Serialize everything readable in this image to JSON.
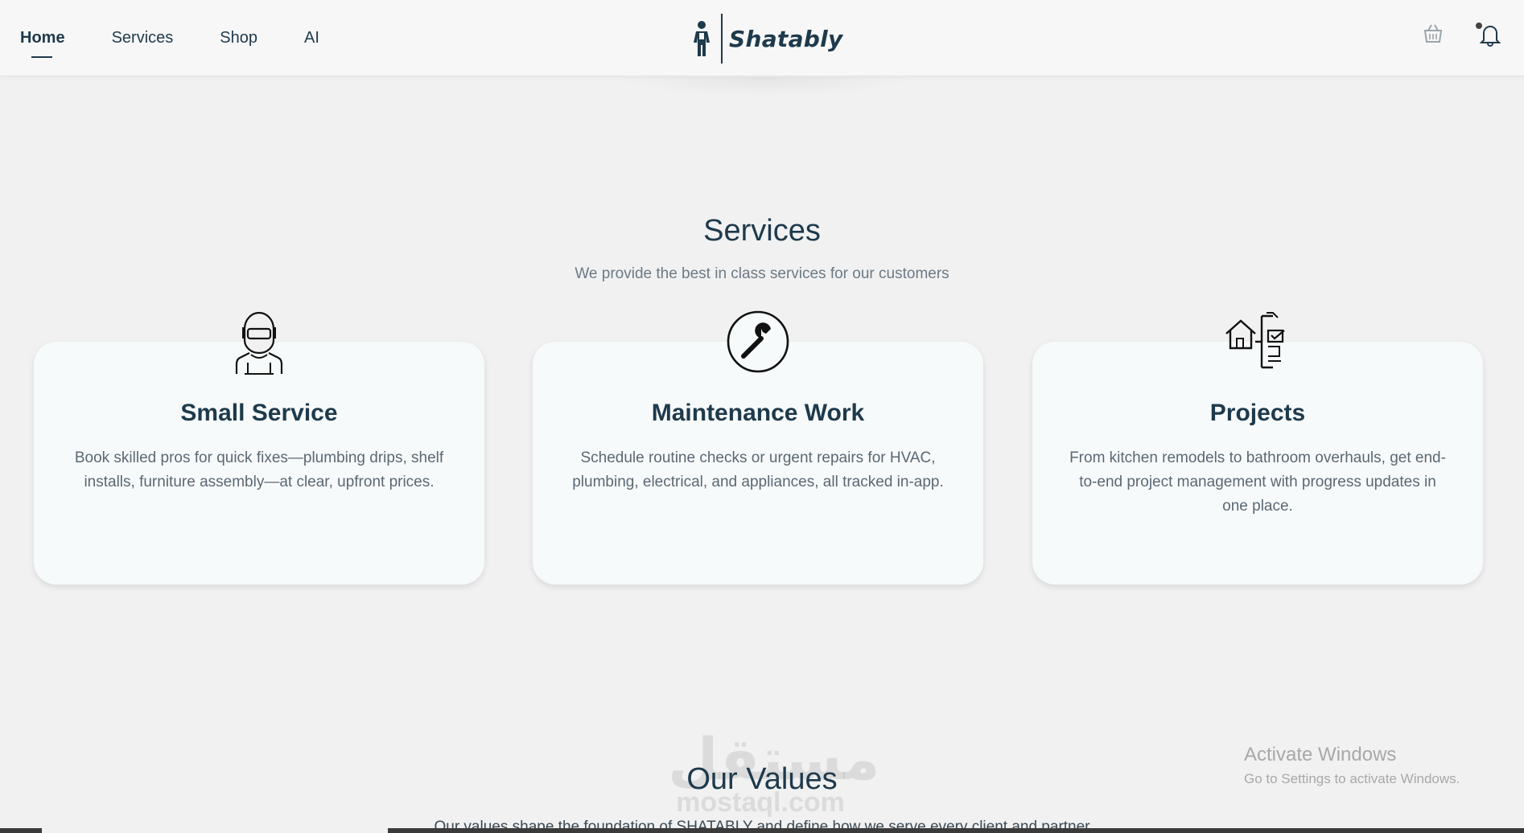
{
  "nav": {
    "items": [
      {
        "label": "Home",
        "active": true
      },
      {
        "label": "Services",
        "active": false
      },
      {
        "label": "Shop",
        "active": false
      },
      {
        "label": "AI",
        "active": false
      }
    ]
  },
  "brand": {
    "name": "Shatably",
    "color": "#1e3a4c"
  },
  "header_icons": [
    "basket-icon",
    "bell-icon",
    "user-icon"
  ],
  "services": {
    "title": "Services",
    "subtitle": "We provide the best in class services for our customers",
    "cards": [
      {
        "icon": "worker-icon",
        "title": "Small Service",
        "description": "Book skilled pros for quick fixes—plumbing drips, shelf installs, furniture assembly—at clear, upfront prices."
      },
      {
        "icon": "wrench-icon",
        "title": "Maintenance Work",
        "description": "Schedule routine checks or urgent repairs for HVAC, plumbing, electrical, and appliances, all tracked in-app."
      },
      {
        "icon": "house-checklist-icon",
        "title": "Projects",
        "description": "From kitchen remodels to bathroom overhauls, get end-to-end project management with progress updates in one place."
      }
    ]
  },
  "values": {
    "title": "Our Values",
    "intro_partial": "Our values shape the foundation of SHATABLY and define how we serve every client and partner"
  },
  "watermark": {
    "arabic": "مستقل",
    "latin": "mostaql.com"
  },
  "os_overlay": {
    "title": "Activate Windows",
    "subtitle": "Go to Settings to activate Windows."
  }
}
